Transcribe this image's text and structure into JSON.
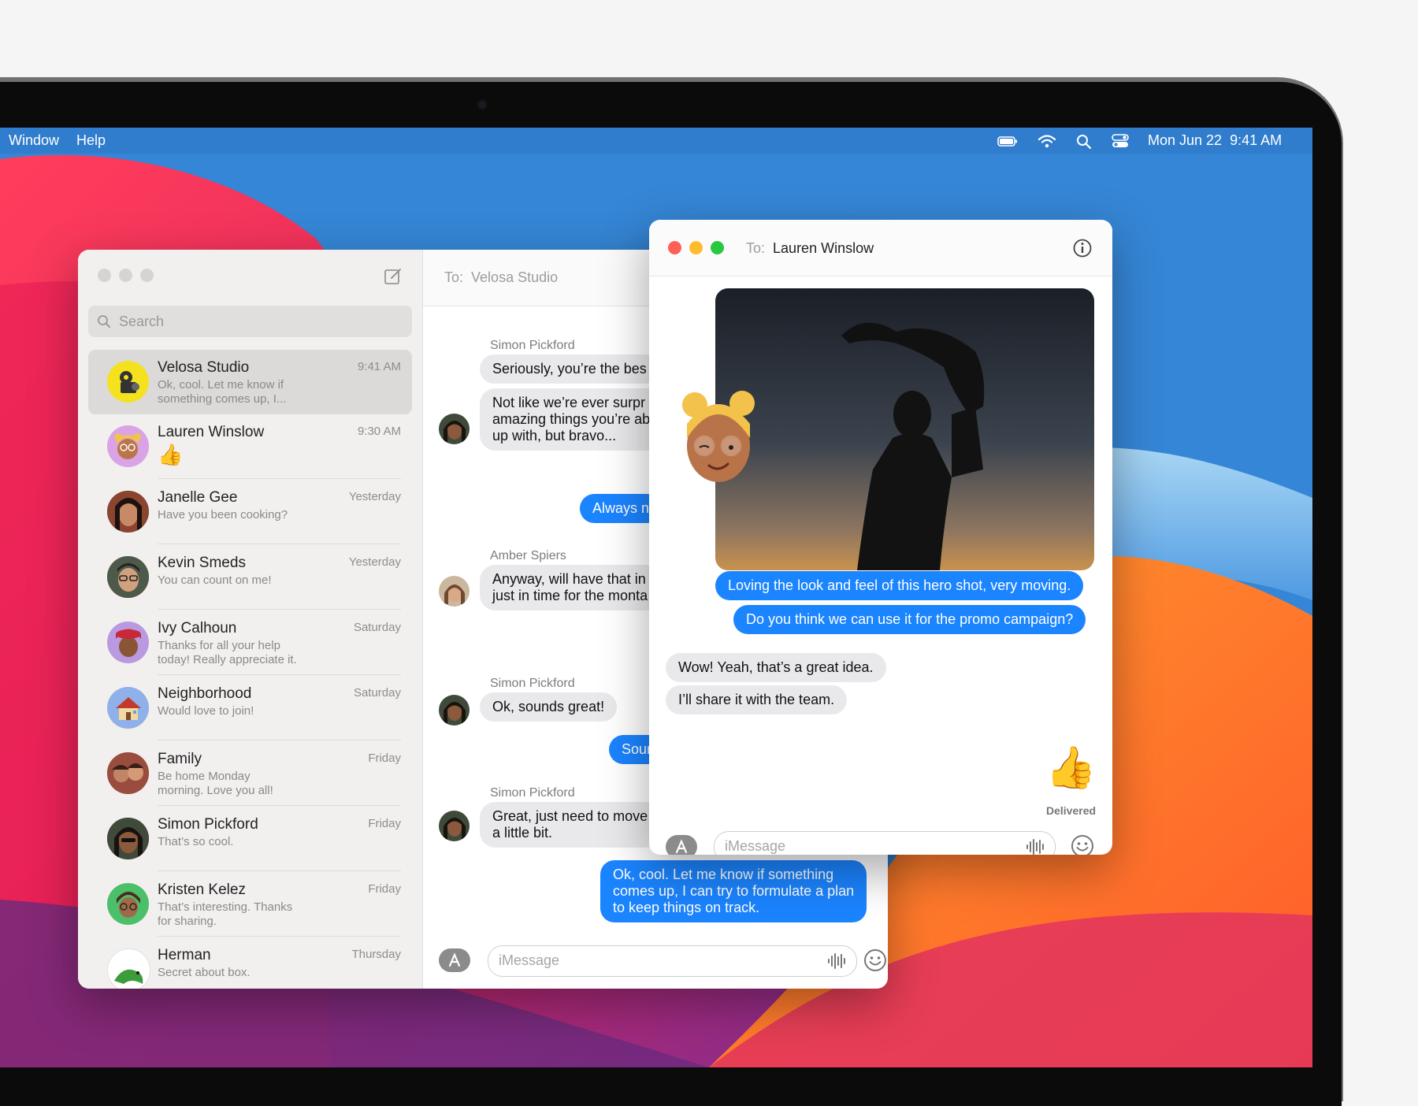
{
  "menubar": {
    "items": [
      "Window",
      "Help"
    ],
    "datetime": "Mon Jun 22  9:41 AM",
    "icons": [
      "battery-icon",
      "wifi-icon",
      "spotlight-search-icon",
      "control-center-icon"
    ]
  },
  "messages_window": {
    "search_placeholder": "Search",
    "to_prefix": "To:",
    "to_name": "Velosa Studio",
    "conversations": [
      {
        "name": "Velosa Studio",
        "time": "9:41 AM",
        "preview": "Ok, cool. Let me know if something comes up, I...",
        "selected": true
      },
      {
        "name": "Lauren Winslow",
        "time": "9:30 AM",
        "preview": "👍"
      },
      {
        "name": "Janelle Gee",
        "time": "Yesterday",
        "preview": "Have you been cooking?"
      },
      {
        "name": "Kevin Smeds",
        "time": "Yesterday",
        "preview": "You can count on me!"
      },
      {
        "name": "Ivy Calhoun",
        "time": "Saturday",
        "preview": "Thanks for all your help today! Really appreciate it."
      },
      {
        "name": "Neighborhood",
        "time": "Saturday",
        "preview": "Would love to join!"
      },
      {
        "name": "Family",
        "time": "Friday",
        "preview": "Be home Monday morning. Love you all!"
      },
      {
        "name": "Simon Pickford",
        "time": "Friday",
        "preview": "That’s so cool."
      },
      {
        "name": "Kristen Kelez",
        "time": "Friday",
        "preview": "That’s interesting. Thanks for sharing."
      },
      {
        "name": "Herman",
        "time": "Thursday",
        "preview": "Secret about box."
      }
    ],
    "thread": {
      "sender1": "Simon Pickford",
      "msg1": "Seriously, you’re the bes",
      "msg2": "Not like we’re ever surpr\namazing things you’re ab\nup with, but bravo...",
      "out1": "Always n",
      "sender2": "Amber Spiers",
      "msg3": "Anyway, will have that in\njust in time for the monta",
      "sender3": "Simon Pickford",
      "msg4": "Ok, sounds great!",
      "out2": "Sour",
      "sender4": "Simon Pickford",
      "msg5": "Great, just need to move\na little bit.",
      "out3": "Ok, cool. Let me know if something\ncomes up, I can try to formulate a plan\nto keep things on track."
    },
    "composer_placeholder": "iMessage"
  },
  "lauren_window": {
    "to_prefix": "To:",
    "to_name": "Lauren Winslow",
    "out1": "Loving the look and feel of this hero shot, very moving.",
    "out2": "Do you think we can use it for the promo campaign?",
    "in1": "Wow! Yeah, that’s a great idea.",
    "in2": "I’ll share it with the team.",
    "reaction": "👍",
    "status": "Delivered",
    "composer_placeholder": "iMessage"
  },
  "colors": {
    "blue_bubble": "#1b84ff",
    "gray_bubble": "#e9e9eb",
    "close": "#fe5f57",
    "minimize": "#febc2e",
    "zoom": "#28c840"
  }
}
